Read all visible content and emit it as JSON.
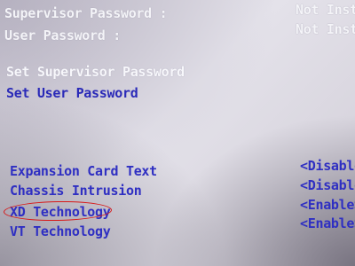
{
  "status": {
    "supervisor_password": {
      "label": "Supervisor Password :",
      "value": "Not Inst"
    },
    "user_password": {
      "label": "User Password :",
      "value": "Not Inst"
    }
  },
  "actions": {
    "set_supervisor_password": "Set Supervisor Password",
    "set_user_password": "Set User Password"
  },
  "settings": [
    {
      "label": "Expansion Card Text",
      "value": "<Disable"
    },
    {
      "label": "Chassis Intrusion",
      "value": "<Disable"
    },
    {
      "label": "XD Technology",
      "value": "<Enable>"
    },
    {
      "label": "VT Technology",
      "value": "<Enable>"
    }
  ],
  "colors": {
    "background": "#dcd9e1",
    "highlight_text": "#f4f4f8",
    "item_text": "#2f2fc2",
    "annotation_oval": "#d81818"
  }
}
